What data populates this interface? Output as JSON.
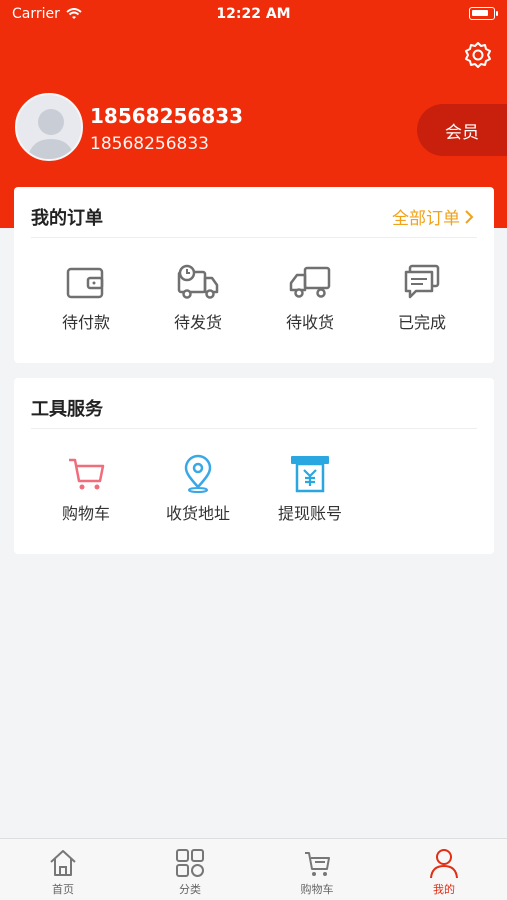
{
  "status_bar": {
    "carrier": "Carrier",
    "time": "12:22 AM"
  },
  "profile": {
    "name": "18568256833",
    "phone": "18568256833",
    "member_label": "会员"
  },
  "orders": {
    "title": "我的订单",
    "all_label": "全部订单",
    "items": [
      {
        "label": "待付款",
        "icon": "wallet-icon"
      },
      {
        "label": "待发货",
        "icon": "truck-clock-icon"
      },
      {
        "label": "待收货",
        "icon": "delivery-truck-icon"
      },
      {
        "label": "已完成",
        "icon": "chat-bubbles-icon"
      }
    ]
  },
  "tools": {
    "title": "工具服务",
    "items": [
      {
        "label": "购物车",
        "icon": "cart-icon",
        "color": "#f06d7c"
      },
      {
        "label": "收货地址",
        "icon": "location-pin-icon",
        "color": "#3aa8e6"
      },
      {
        "label": "提现账号",
        "icon": "atm-yuan-icon",
        "color": "#2aa6e0"
      }
    ]
  },
  "tabbar": {
    "tabs": [
      {
        "label": "首页",
        "icon": "home-icon"
      },
      {
        "label": "分类",
        "icon": "grid-icon"
      },
      {
        "label": "购物车",
        "icon": "cart-icon"
      },
      {
        "label": "我的",
        "icon": "person-icon",
        "active": true
      }
    ]
  },
  "colors": {
    "header": "#ef2d0b",
    "accent": "#f0a21a",
    "active_tab": "#e12e14"
  }
}
